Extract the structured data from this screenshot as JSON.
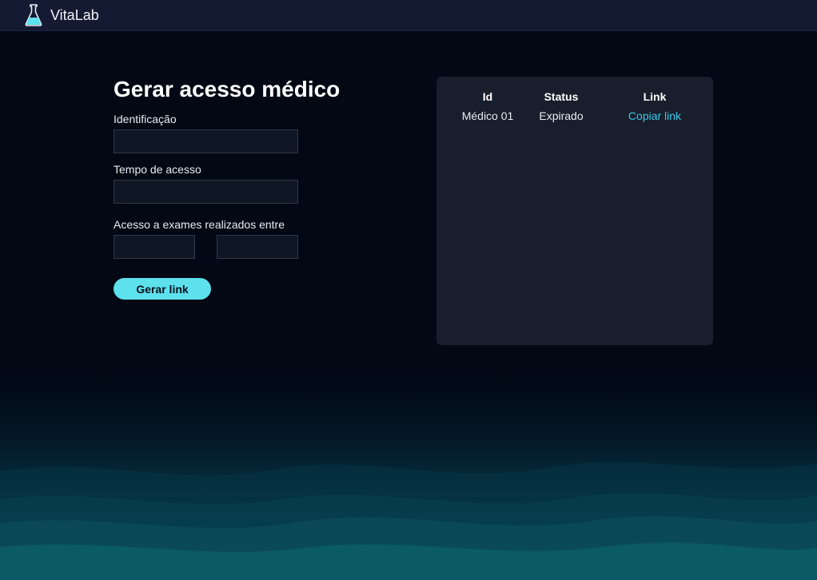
{
  "app": {
    "brand": "VitaLab",
    "logo_icon": "flask-icon",
    "colors": {
      "background": "#020814",
      "navbar": "#141a32",
      "accent": "#5ce1ed",
      "link": "#3fc8e6",
      "panel": "#181e2c"
    }
  },
  "form": {
    "title": "Gerar acesso médico",
    "identification": {
      "label": "Identificação",
      "value": ""
    },
    "access_time": {
      "label": "Tempo de acesso",
      "value": ""
    },
    "exam_range": {
      "label": "Acesso a exames realizados entre",
      "start": "",
      "end": ""
    },
    "submit_label": "Gerar link"
  },
  "table": {
    "headers": [
      "Id",
      "Status",
      "Link"
    ],
    "rows": [
      {
        "id": "Médico 01",
        "status": "Expirado",
        "link": "Copiar link"
      }
    ]
  }
}
